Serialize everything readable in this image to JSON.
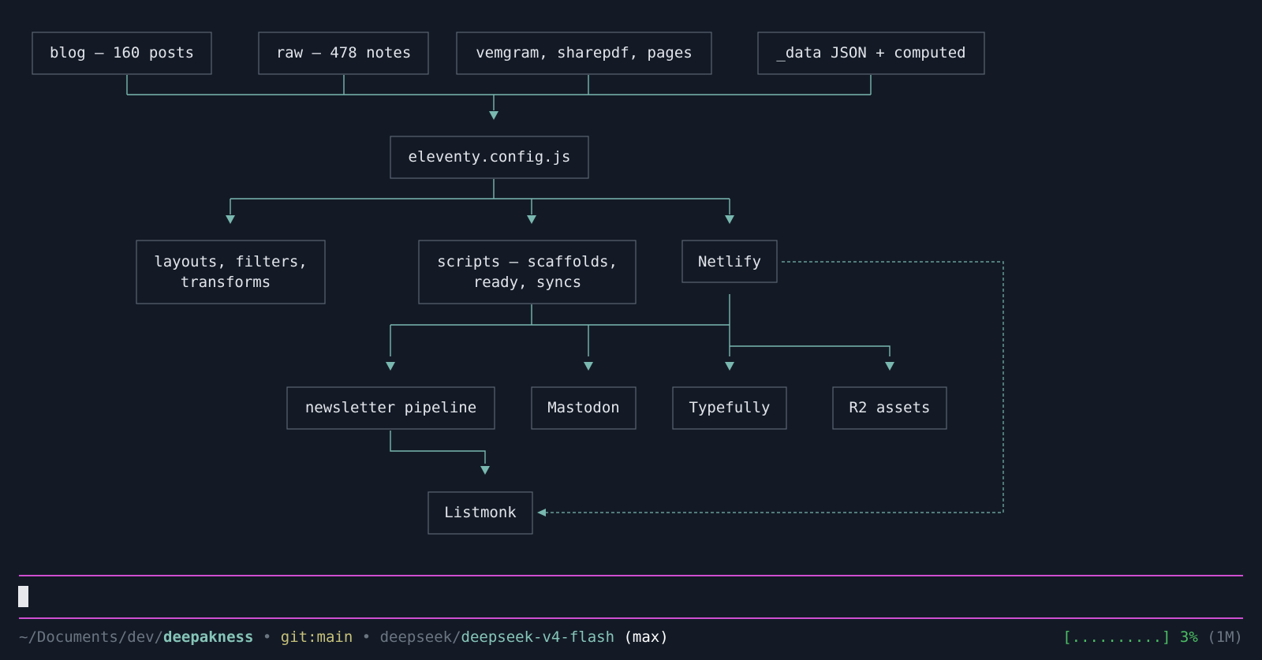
{
  "diagram": {
    "nodes": {
      "blog": "blog — 160 posts",
      "raw": "raw — 478 notes",
      "vemgram": "vemgram, sharepdf, pages",
      "data": "_data JSON + computed",
      "config": "eleventy.config.js",
      "layouts_l1": "layouts, filters,",
      "layouts_l2": "transforms",
      "scripts_l1": "scripts — scaffolds,",
      "scripts_l2": "ready, syncs",
      "netlify": "Netlify",
      "newsletter": "newsletter pipeline",
      "mastodon": "Mastodon",
      "typefully": "Typefully",
      "r2": "R2 assets",
      "listmonk": "Listmonk"
    }
  },
  "status": {
    "path_prefix": "~/Documents/dev/",
    "repo": "deepakness",
    "sep1": " • ",
    "git": "git:main",
    "sep2": " • ",
    "provider": "deepseek/",
    "model": "deepseek-v4-flash",
    "mode": " (max)",
    "bar": "[..........]",
    "percent": " 3%",
    "context": " (1M)"
  },
  "colors": {
    "background": "#131a26",
    "edge": "#79b8b0",
    "rule": "#cf4ed0",
    "repo": "#86c5b8",
    "branch": "#c7c27a",
    "progress": "#4cbe63"
  }
}
